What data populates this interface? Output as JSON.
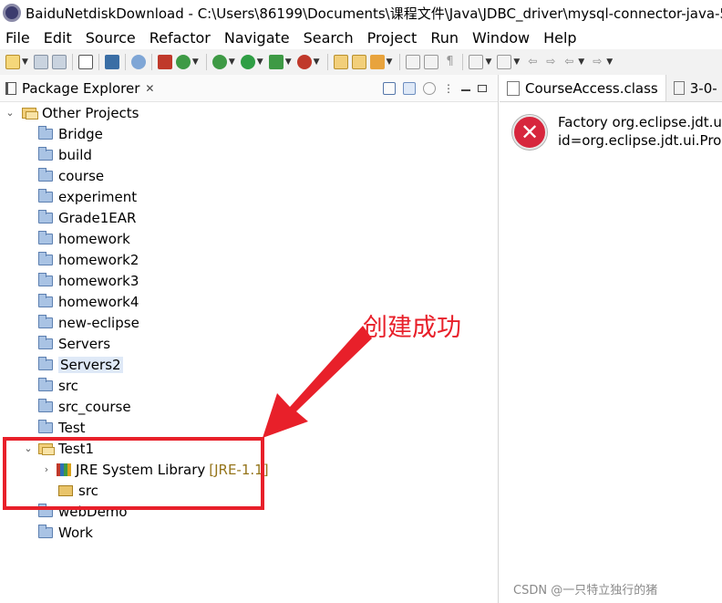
{
  "window": {
    "title": "BaiduNetdiskDownload - C:\\Users\\86199\\Documents\\课程文件\\Java\\JDBC_driver\\mysql-connector-java-5.1"
  },
  "menubar": [
    "File",
    "Edit",
    "Source",
    "Refactor",
    "Navigate",
    "Search",
    "Project",
    "Run",
    "Window",
    "Help"
  ],
  "package_explorer": {
    "title": "Package Explorer",
    "close": "✕",
    "root": "Other Projects",
    "projects": [
      "Bridge",
      "build",
      "course",
      "experiment",
      "Grade1EAR",
      "homework",
      "homework2",
      "homework3",
      "homework4",
      "new-eclipse",
      "Servers",
      "Servers2",
      "src",
      "src_course",
      "Test",
      "Test1",
      "webDemo",
      "Work"
    ],
    "selected": "Servers2",
    "test1_children": {
      "library": "JRE System Library",
      "library_suffix": "[JRE-1.1]",
      "source_folder": "src"
    }
  },
  "editor": {
    "tabs": [
      "CourseAccess.class",
      "3-0-"
    ],
    "error_line1": "Factory org.eclipse.jdt.ui",
    "error_line2": "id=org.eclipse.jdt.ui.Prop"
  },
  "annotation": {
    "text": "创建成功",
    "color": "#e8202a"
  },
  "watermark": "CSDN @一只特立独行的猪  ",
  "icons": [
    "app-icon",
    "package-explorer-icon",
    "folder-icon",
    "open-folder-icon",
    "library-icon",
    "package-icon",
    "class-file-icon",
    "error-icon"
  ]
}
